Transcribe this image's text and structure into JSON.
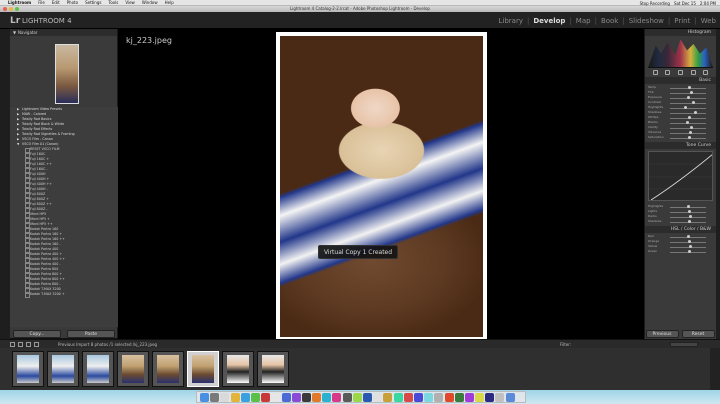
{
  "menubar": {
    "app": "Lightroom",
    "items": [
      "File",
      "Edit",
      "Photo",
      "Settings",
      "Tools",
      "View",
      "Window",
      "Help"
    ],
    "right": [
      "Stop Recording",
      "Sat Dec 15",
      "2:04 PM"
    ]
  },
  "window": {
    "title": "Lightroom 4 Catalog-2-2.lrcat - Adobe Photoshop Lightroom - Develop"
  },
  "lr": {
    "logo": "Lr",
    "name": "LIGHTROOM 4",
    "modules": [
      "Library",
      "Develop",
      "Map",
      "Book",
      "Slideshow",
      "Print",
      "Web"
    ],
    "active": "Develop"
  },
  "left": {
    "navigator": "Navigator",
    "presets": [
      {
        "label": "Lightroom Video Presets",
        "type": "folder"
      },
      {
        "label": "MAW - Colored",
        "type": "folder"
      },
      {
        "label": "Totally Rad Basics",
        "type": "folder"
      },
      {
        "label": "Totally Rad Black & White",
        "type": "folder"
      },
      {
        "label": "Totally Rad Effects",
        "type": "folder"
      },
      {
        "label": "Totally Rad Vignettes & Framing",
        "type": "folder"
      },
      {
        "label": "VSCO Film - Canon",
        "type": "folder"
      },
      {
        "label": "VSCO Film 01 (Canon)",
        "type": "folder"
      },
      {
        "label": "RESET VSCO FILM",
        "type": "child"
      },
      {
        "label": "Fuji 160C",
        "type": "child"
      },
      {
        "label": "Fuji 160C +",
        "type": "child"
      },
      {
        "label": "Fuji 160C ++",
        "type": "child"
      },
      {
        "label": "Fuji 160C -",
        "type": "child"
      },
      {
        "label": "Fuji 400H",
        "type": "child"
      },
      {
        "label": "Fuji 400H +",
        "type": "child"
      },
      {
        "label": "Fuji 400H ++",
        "type": "child"
      },
      {
        "label": "Fuji 400H -",
        "type": "child"
      },
      {
        "label": "Fuji 800Z",
        "type": "child"
      },
      {
        "label": "Fuji 800Z +",
        "type": "child"
      },
      {
        "label": "Fuji 800Z ++",
        "type": "child"
      },
      {
        "label": "Fuji 800Z -",
        "type": "child"
      },
      {
        "label": "Ilford HP5",
        "type": "child"
      },
      {
        "label": "Ilford HP5 +",
        "type": "child"
      },
      {
        "label": "Ilford HP5 ++",
        "type": "child"
      },
      {
        "label": "Kodak Portra 160",
        "type": "child"
      },
      {
        "label": "Kodak Portra 160 +",
        "type": "child"
      },
      {
        "label": "Kodak Portra 160 ++",
        "type": "child"
      },
      {
        "label": "Kodak Portra 160 -",
        "type": "child"
      },
      {
        "label": "Kodak Portra 400",
        "type": "child"
      },
      {
        "label": "Kodak Portra 400 +",
        "type": "child"
      },
      {
        "label": "Kodak Portra 400 ++",
        "type": "child"
      },
      {
        "label": "Kodak Portra 400 -",
        "type": "child"
      },
      {
        "label": "Kodak Portra 800",
        "type": "child"
      },
      {
        "label": "Kodak Portra 800 +",
        "type": "child"
      },
      {
        "label": "Kodak Portra 800 ++",
        "type": "child"
      },
      {
        "label": "Kodak Portra 800 -",
        "type": "child"
      },
      {
        "label": "Kodak T-MAX 3200",
        "type": "child"
      },
      {
        "label": "Kodak T-MAX 3200 +",
        "type": "child"
      }
    ],
    "copy": "Copy...",
    "paste": "Paste"
  },
  "center": {
    "filename": "kj_223.jpeg",
    "toast": "Virtual Copy 1 Created"
  },
  "right": {
    "histogram": "Histogram",
    "basic": "Basic",
    "sliders1": [
      "Temp",
      "Tint",
      "Exposure",
      "Contrast",
      "Highlights",
      "Shadows",
      "Whites",
      "Blacks",
      "Clarity",
      "Vibrance",
      "Saturation"
    ],
    "tonecurve": "Tone Curve",
    "sliders2": [
      "Highlights",
      "Lights",
      "Darks",
      "Shadows"
    ],
    "hsl": "HSL / Color / B&W",
    "sliders3": [
      "Red",
      "Orange",
      "Yellow",
      "Green"
    ],
    "previous": "Previous",
    "reset": "Reset"
  },
  "film": {
    "info": "Previous Import   8 photos /1 selected /kj_223.jpeg",
    "filter": "Filter:",
    "thumbs": [
      "boy",
      "boy",
      "boy",
      "baby",
      "baby",
      "baby-selected",
      "boy2",
      "boy2"
    ]
  },
  "colors": {
    "accent": "#4a8bd8"
  }
}
